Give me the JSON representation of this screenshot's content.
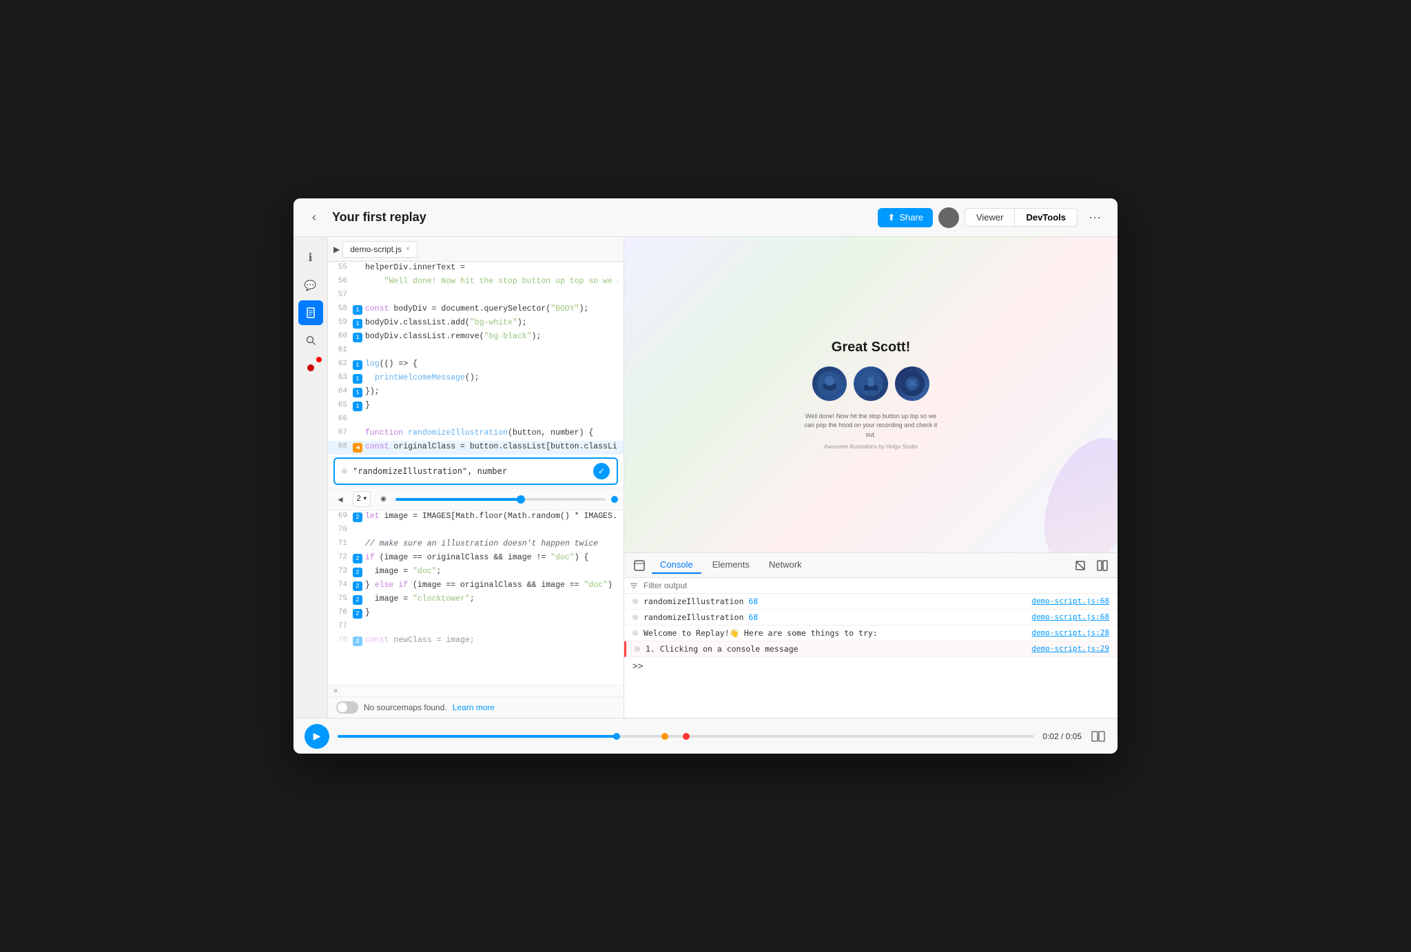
{
  "header": {
    "back_label": "‹",
    "title": "Your first replay",
    "share_label": "Share",
    "avatar_color": "#666",
    "viewer_label": "Viewer",
    "devtools_label": "DevTools",
    "more_label": "···"
  },
  "sidebar": {
    "icons": [
      {
        "name": "info-icon",
        "symbol": "ℹ",
        "active": false
      },
      {
        "name": "comment-icon",
        "symbol": "💬",
        "active": false
      },
      {
        "name": "document-icon",
        "symbol": "📄",
        "active": true
      },
      {
        "name": "search-icon",
        "symbol": "🔍",
        "active": false
      },
      {
        "name": "record-icon",
        "symbol": "⏺",
        "active": false,
        "badge": true
      }
    ]
  },
  "file_tab": {
    "filename": "demo-script.js",
    "close_label": "×"
  },
  "code_lines": [
    {
      "num": 55,
      "hit": null,
      "text": "helperDiv.innerText =",
      "tokens": [
        {
          "t": "plain",
          "v": "helperDiv.innerText ="
        }
      ]
    },
    {
      "num": 56,
      "hit": null,
      "text": "  \"Well done! Now hit the stop button up top so we ca",
      "tokens": [
        {
          "t": "str",
          "v": "  \"Well done! Now hit the stop button up top so we ca"
        }
      ]
    },
    {
      "num": 57,
      "hit": null,
      "text": "",
      "tokens": []
    },
    {
      "num": 58,
      "hit": "1",
      "text": "const bodyDiv = document.querySelector(\"BODY\");",
      "tokens": [
        {
          "t": "kw",
          "v": "const "
        },
        {
          "t": "plain",
          "v": "bodyDiv = document.querySelector("
        },
        {
          "t": "str",
          "v": "\"BODY\""
        },
        {
          "t": "plain",
          "v": ");"
        }
      ]
    },
    {
      "num": 59,
      "hit": "1",
      "text": "bodyDiv.classList.add(\"bg-white\");",
      "tokens": [
        {
          "t": "plain",
          "v": "bodyDiv.classList.add("
        },
        {
          "t": "str",
          "v": "\"bg-white\""
        },
        {
          "t": "plain",
          "v": ");"
        }
      ]
    },
    {
      "num": 60,
      "hit": "1",
      "text": "bodyDiv.classList.remove(\"bg-black\");",
      "tokens": [
        {
          "t": "plain",
          "v": "bodyDiv.classList.remove("
        },
        {
          "t": "str",
          "v": "\"bg-black\""
        },
        {
          "t": "plain",
          "v": ");"
        }
      ]
    },
    {
      "num": 61,
      "hit": null,
      "text": "",
      "tokens": []
    },
    {
      "num": 62,
      "hit": "1",
      "text": "log(() => {",
      "tokens": [
        {
          "t": "fn",
          "v": "log"
        },
        {
          "t": "plain",
          "v": "(() => {"
        }
      ]
    },
    {
      "num": 63,
      "hit": "1",
      "text": "  printWelcomeMessage();",
      "tokens": [
        {
          "t": "plain",
          "v": "  "
        },
        {
          "t": "fn",
          "v": "printWelcomeMessage"
        },
        {
          "t": "plain",
          "v": "();"
        }
      ]
    },
    {
      "num": 64,
      "hit": "1",
      "text": "});",
      "tokens": [
        {
          "t": "plain",
          "v": "});"
        }
      ]
    },
    {
      "num": 65,
      "hit": "1",
      "text": "}",
      "tokens": [
        {
          "t": "plain",
          "v": "}"
        }
      ]
    },
    {
      "num": 66,
      "hit": null,
      "text": "",
      "tokens": []
    },
    {
      "num": 67,
      "hit": null,
      "text": "function randomizeIllustration(button, number) {",
      "tokens": [
        {
          "t": "kw",
          "v": "function "
        },
        {
          "t": "fn",
          "v": "randomizeIllustration"
        },
        {
          "t": "plain",
          "v": "(button, number) {"
        }
      ]
    },
    {
      "num": 68,
      "hit": "2",
      "text": "  const originalClass = button.classList[button.classLi",
      "tokens": [
        {
          "t": "kw",
          "v": "  const "
        },
        {
          "t": "plain",
          "v": "originalClass = button.classList[button.classLi"
        }
      ],
      "has_arrow": true
    }
  ],
  "input_popup": {
    "dot_color": "#ccc",
    "value": "\"randomizeIllustration\", number",
    "confirm_label": "✓"
  },
  "step_controls": {
    "prev_label": "◄",
    "step_value": "2",
    "dropdown_arrow": "▾",
    "next_label": null,
    "slider_value": 60
  },
  "code_lines_lower": [
    {
      "num": 69,
      "hit": "2",
      "text": "let image = IMAGES[Math.floor(Math.random() * IMAGES.",
      "tokens": [
        {
          "t": "kw",
          "v": "let "
        },
        {
          "t": "plain",
          "v": "image = IMAGES[Math.floor(Math.random() * IMAGES."
        }
      ]
    },
    {
      "num": 70,
      "hit": null,
      "text": "",
      "tokens": []
    },
    {
      "num": 71,
      "hit": null,
      "text": "// make sure an illustration doesn't happen twice",
      "tokens": [
        {
          "t": "cmt",
          "v": "// make sure an illustration doesn't happen twice"
        }
      ]
    },
    {
      "num": 72,
      "hit": "2",
      "text": "if (image == originalClass && image != \"doc\") {",
      "tokens": [
        {
          "t": "kw",
          "v": "if "
        },
        {
          "t": "plain",
          "v": "(image == originalClass && image != "
        },
        {
          "t": "str",
          "v": "\"doc\""
        },
        {
          "t": "plain",
          "v": ") {"
        }
      ]
    },
    {
      "num": 73,
      "hit": "2",
      "text": "  image = \"doc\";",
      "tokens": [
        {
          "t": "plain",
          "v": "  image = "
        },
        {
          "t": "str",
          "v": "\"doc\""
        },
        {
          "t": "plain",
          "v": ";"
        }
      ]
    },
    {
      "num": 74,
      "hit": "2",
      "text": "} else if (image == originalClass && image == \"doc\") {",
      "tokens": [
        {
          "t": "plain",
          "v": "} "
        },
        {
          "t": "kw",
          "v": "else if "
        },
        {
          "t": "plain",
          "v": "(image == originalClass && image == "
        },
        {
          "t": "str",
          "v": "\"doc\""
        },
        {
          "t": "plain",
          "v": ") {"
        }
      ]
    },
    {
      "num": 75,
      "hit": "2",
      "text": "  image = \"clocktower\";",
      "tokens": [
        {
          "t": "plain",
          "v": "  image = "
        },
        {
          "t": "str",
          "v": "\"clocktower\""
        },
        {
          "t": "plain",
          "v": ";"
        }
      ]
    },
    {
      "num": 76,
      "hit": "2",
      "text": "}",
      "tokens": [
        {
          "t": "plain",
          "v": "}"
        }
      ]
    },
    {
      "num": 77,
      "hit": null,
      "text": "",
      "tokens": []
    },
    {
      "num": 78,
      "hit": "2",
      "text": "const newClass = image;",
      "tokens": [
        {
          "t": "kw",
          "v": "  const "
        },
        {
          "t": "plain",
          "v": "newClass = image;"
        }
      ]
    }
  ],
  "sourcemaps": {
    "toggle_label": "No sourcemaps found.",
    "link_label": "Learn more"
  },
  "preview": {
    "title": "Great Scott!",
    "subtext": "Well done! Now hit the stop button up top so we can pop the hood on your recording and check it out.",
    "credit": "Awesome illustrations by Helga Studio"
  },
  "devtools": {
    "cursor_icon": "⊡",
    "tabs": [
      {
        "label": "Console",
        "active": false
      },
      {
        "label": "Elements",
        "active": false
      },
      {
        "label": "Network",
        "active": false
      }
    ],
    "filter_placeholder": "Filter output",
    "console_rows": [
      {
        "text_parts": [
          {
            "t": "fn-name",
            "v": "randomizeIllustration "
          },
          {
            "t": "fn-num",
            "v": "68"
          }
        ],
        "link": "demo-script.js:68"
      },
      {
        "text_parts": [
          {
            "t": "fn-name",
            "v": "randomizeIllustration "
          },
          {
            "t": "fn-num",
            "v": "68"
          }
        ],
        "link": "demo-script.js:68"
      },
      {
        "text_parts": [
          {
            "t": "plain",
            "v": "Welcome to Replay!👋 Here are some things to try:"
          }
        ],
        "link": "demo-script.js:28",
        "multiline": true
      },
      {
        "text_parts": [
          {
            "t": "plain",
            "v": "1. Clicking on a console message"
          }
        ],
        "link": "demo-script.js:29",
        "is_error": true
      }
    ],
    "prompt": ">>"
  },
  "timeline": {
    "play_label": "▶",
    "current_time": "0:02",
    "total_time": "0:05",
    "time_separator": " / "
  }
}
